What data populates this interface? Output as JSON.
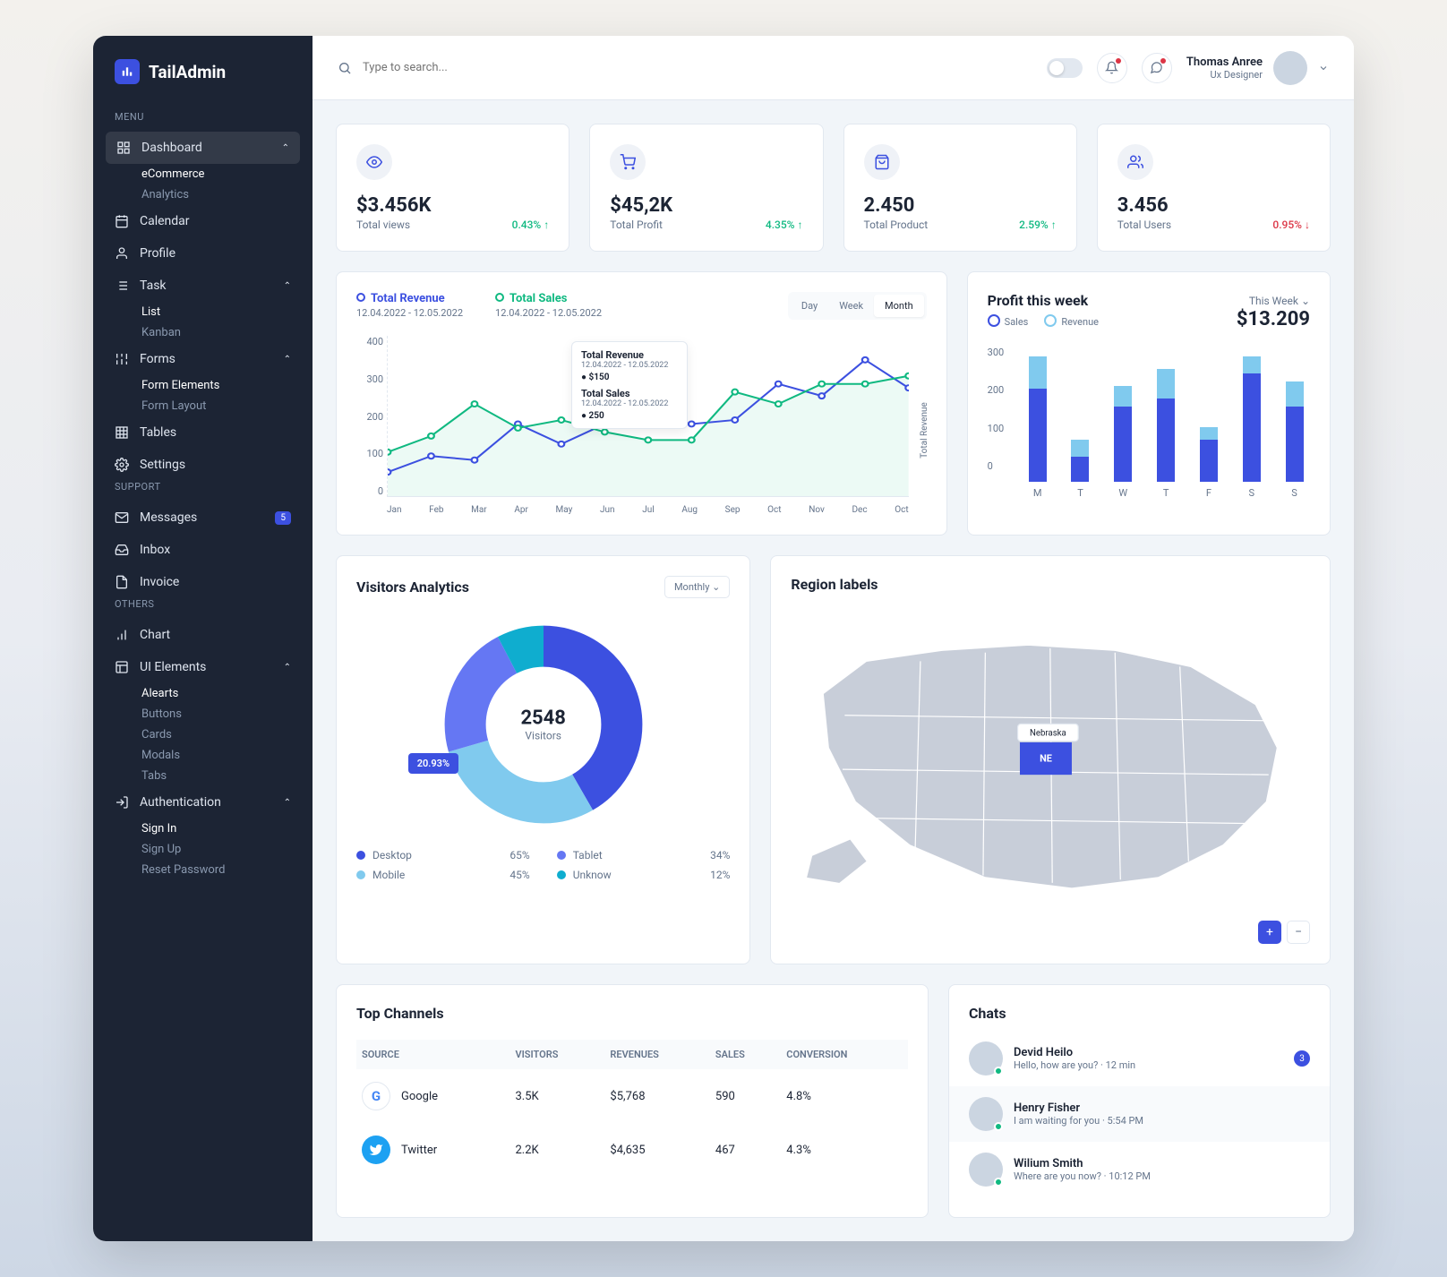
{
  "brand": "TailAdmin",
  "sidebar": {
    "sections": [
      {
        "label": "MENU",
        "items": [
          {
            "label": "Dashboard",
            "expanded": true,
            "sub": [
              "eCommerce",
              "Analytics"
            ],
            "activeSub": 0
          },
          {
            "label": "Calendar"
          },
          {
            "label": "Profile"
          },
          {
            "label": "Task",
            "expanded": true,
            "sub": [
              "List",
              "Kanban"
            ],
            "activeSub": 0
          },
          {
            "label": "Forms",
            "expanded": true,
            "sub": [
              "Form Elements",
              "Form Layout"
            ],
            "activeSub": 0
          },
          {
            "label": "Tables"
          },
          {
            "label": "Settings"
          }
        ]
      },
      {
        "label": "SUPPORT",
        "items": [
          {
            "label": "Messages",
            "badge": "5"
          },
          {
            "label": "Inbox"
          },
          {
            "label": "Invoice"
          }
        ]
      },
      {
        "label": "OTHERS",
        "items": [
          {
            "label": "Chart"
          },
          {
            "label": "UI Elements",
            "expanded": true,
            "sub": [
              "Alearts",
              "Buttons",
              "Cards",
              "Modals",
              "Tabs"
            ],
            "activeSub": 0
          },
          {
            "label": "Authentication",
            "expanded": true,
            "sub": [
              "Sign In",
              "Sign Up",
              "Reset Password"
            ],
            "activeSub": 0
          }
        ]
      }
    ]
  },
  "topbar": {
    "search_placeholder": "Type to search...",
    "user_name": "Thomas Anree",
    "user_role": "Ux Designer"
  },
  "stats": [
    {
      "value": "$3.456K",
      "label": "Total views",
      "delta": "0.43%",
      "dir": "up",
      "icon": "eye"
    },
    {
      "value": "$45,2K",
      "label": "Total Profit",
      "delta": "4.35%",
      "dir": "up",
      "icon": "cart"
    },
    {
      "value": "2.450",
      "label": "Total Product",
      "delta": "2.59%",
      "dir": "up",
      "icon": "bag"
    },
    {
      "value": "3.456",
      "label": "Total Users",
      "delta": "0.95%",
      "dir": "down",
      "icon": "users"
    }
  ],
  "revenue": {
    "series": [
      {
        "name": "Total Revenue",
        "range": "12.04.2022 - 12.05.2022",
        "color": "#3c50e0"
      },
      {
        "name": "Total Sales",
        "range": "12.04.2022 - 12.05.2022",
        "color": "#10b981"
      }
    ],
    "periods": [
      "Day",
      "Week",
      "Month"
    ],
    "active_period": 2,
    "tooltip": {
      "t1": "Total Revenue",
      "t1sub": "12.04.2022 - 12.05.2022",
      "t1val": "$150",
      "t2": "Total Sales",
      "t2sub": "12.04.2022 - 12.05.2022",
      "t2val": "250"
    },
    "yaxis_label": "Total Revenue"
  },
  "profit": {
    "title": "Profit this week",
    "select": "This Week",
    "legend": [
      "Sales",
      "Revenue"
    ],
    "value": "$13.209"
  },
  "visitors": {
    "title": "Visitors Analytics",
    "select": "Monthly",
    "center_value": "2548",
    "center_label": "Visitors",
    "badge": "20.93%",
    "legend": [
      {
        "name": "Desktop",
        "pct": "65%",
        "color": "#3c50e0"
      },
      {
        "name": "Tablet",
        "pct": "34%",
        "color": "#6577f3"
      },
      {
        "name": "Mobile",
        "pct": "45%",
        "color": "#80caee"
      },
      {
        "name": "Unknow",
        "pct": "12%",
        "color": "#0fadcf"
      }
    ]
  },
  "region": {
    "title": "Region labels",
    "highlight": {
      "label": "Nebraska",
      "code": "NE"
    }
  },
  "channels": {
    "title": "Top Channels",
    "headers": [
      "SOURCE",
      "VISITORS",
      "REVENUES",
      "SALES",
      "CONVERSION"
    ],
    "rows": [
      {
        "source": "Google",
        "visitors": "3.5K",
        "revenue": "$5,768",
        "sales": "590",
        "conv": "4.8%",
        "color": "#fff",
        "border": "#e2e8f0"
      },
      {
        "source": "Twitter",
        "visitors": "2.2K",
        "revenue": "$4,635",
        "sales": "467",
        "conv": "4.3%",
        "color": "#1da1f2"
      }
    ]
  },
  "chats": {
    "title": "Chats",
    "items": [
      {
        "name": "Devid Heilo",
        "msg": "Hello, how are you?",
        "time": "12 min",
        "badge": "3",
        "status": "#10b981"
      },
      {
        "name": "Henry Fisher",
        "msg": "I am waiting for you",
        "time": "5:54 PM",
        "status": "#10b981",
        "hover": true
      },
      {
        "name": "Wilium Smith",
        "msg": "Where are you now?",
        "time": "10:12 PM",
        "status": "#10b981"
      }
    ]
  },
  "chart_data": [
    {
      "type": "line",
      "title": "Total Revenue vs Total Sales",
      "x": [
        "Jan",
        "Feb",
        "Mar",
        "Apr",
        "May",
        "Jun",
        "Jul",
        "Aug",
        "Sep",
        "Oct",
        "Nov",
        "Dec",
        "Oct"
      ],
      "ylim": [
        0,
        400
      ],
      "yticks": [
        0,
        100,
        200,
        300,
        400
      ],
      "series": [
        {
          "name": "Total Revenue",
          "color": "#3c50e0",
          "values": [
            60,
            100,
            90,
            180,
            130,
            180,
            200,
            180,
            190,
            280,
            250,
            340,
            270
          ]
        },
        {
          "name": "Total Sales",
          "color": "#10b981",
          "values": [
            110,
            150,
            230,
            170,
            190,
            160,
            140,
            140,
            260,
            230,
            280,
            280,
            300
          ]
        }
      ]
    },
    {
      "type": "bar",
      "title": "Profit this week",
      "categories": [
        "M",
        "T",
        "W",
        "T",
        "F",
        "S",
        "S"
      ],
      "ylim": [
        0,
        300
      ],
      "yticks": [
        0,
        100,
        200,
        300
      ],
      "series": [
        {
          "name": "Sales",
          "color": "#3c50e0",
          "values": [
            230,
            60,
            180,
            200,
            100,
            260,
            180
          ]
        },
        {
          "name": "Revenue",
          "color": "#80caee",
          "values": [
            80,
            40,
            50,
            70,
            30,
            40,
            60
          ]
        }
      ]
    },
    {
      "type": "pie",
      "title": "Visitors Analytics",
      "total_label": "2548",
      "slices": [
        {
          "name": "Desktop",
          "pct": 65,
          "color": "#3c50e0"
        },
        {
          "name": "Mobile",
          "pct": 45,
          "color": "#80caee"
        },
        {
          "name": "Tablet",
          "pct": 34,
          "color": "#6577f3"
        },
        {
          "name": "Unknow",
          "pct": 12,
          "color": "#0fadcf"
        }
      ]
    }
  ]
}
